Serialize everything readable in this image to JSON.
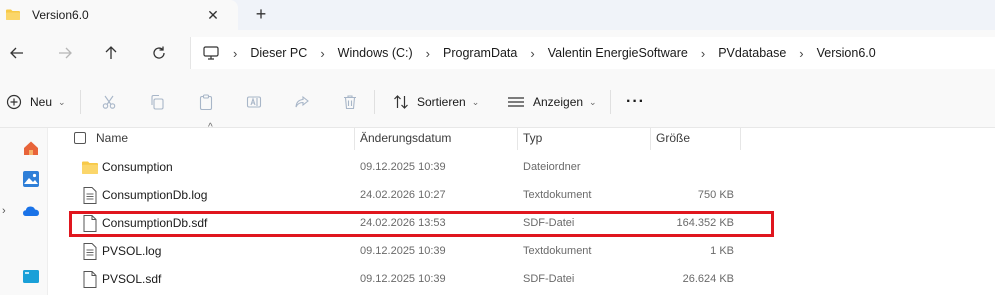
{
  "tab": {
    "title": "Version6.0",
    "close_glyph": "✕",
    "new_tab_glyph": "+"
  },
  "nav": {
    "back_icon": "arrow-left-icon",
    "forward_icon": "arrow-right-icon",
    "up_icon": "arrow-up-icon",
    "refresh_icon": "refresh-icon"
  },
  "address": {
    "crumbs": [
      "Dieser PC",
      "Windows (C:)",
      "ProgramData",
      "Valentin EnergieSoftware",
      "PVdatabase",
      "Version6.0"
    ]
  },
  "commands": {
    "new_label": "Neu",
    "sort_label": "Sortieren",
    "view_label": "Anzeigen",
    "more_glyph": "···"
  },
  "columns": {
    "name": "Name",
    "date": "Änderungsdatum",
    "type": "Typ",
    "size": "Größe"
  },
  "files": [
    {
      "name": "Consumption",
      "date": "09.12.2025 10:39",
      "type": "Dateiordner",
      "size": "",
      "icon": "folder-icon"
    },
    {
      "name": "ConsumptionDb.log",
      "date": "24.02.2026 10:27",
      "type": "Textdokument",
      "size": "750 KB",
      "icon": "text-file-icon"
    },
    {
      "name": "ConsumptionDb.sdf",
      "date": "24.02.2026 13:53",
      "type": "SDF-Datei",
      "size": "164.352 KB",
      "icon": "file-icon"
    },
    {
      "name": "PVSOL.log",
      "date": "09.12.2025 10:39",
      "type": "Textdokument",
      "size": "1 KB",
      "icon": "text-file-icon"
    },
    {
      "name": "PVSOL.sdf",
      "date": "09.12.2025 10:39",
      "type": "SDF-Datei",
      "size": "26.624 KB",
      "icon": "file-icon"
    }
  ],
  "colors": {
    "folder": "#f7c948",
    "highlight": "#e0161e",
    "accent": "#1a73e8"
  }
}
